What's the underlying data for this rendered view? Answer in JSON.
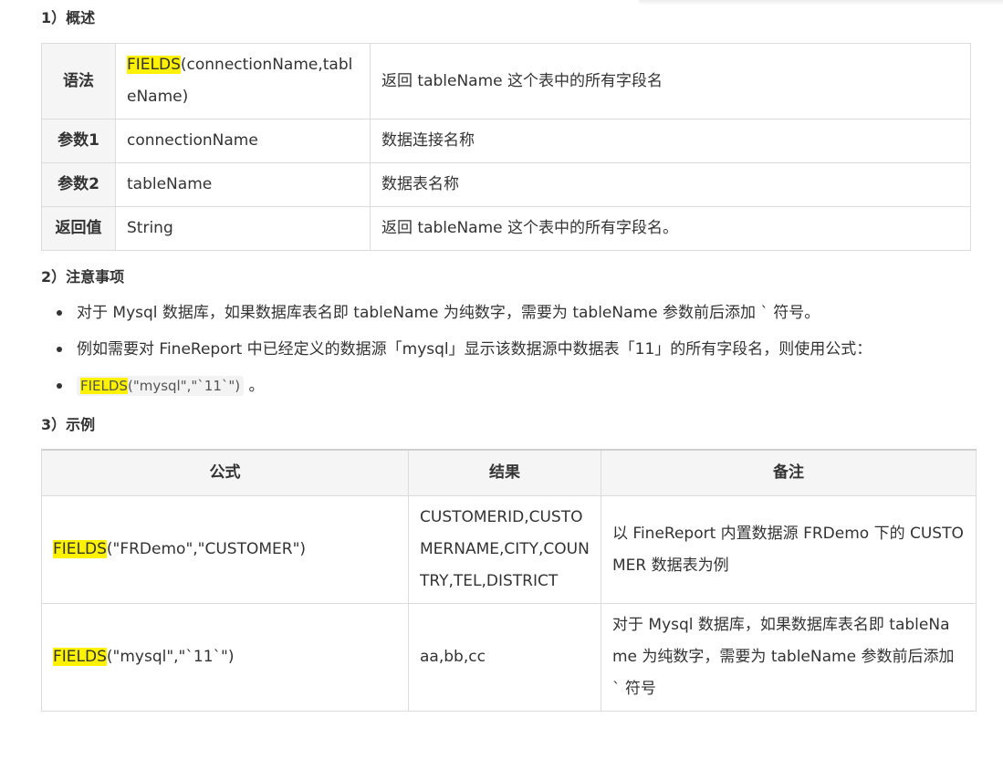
{
  "sections": {
    "overview_heading": "1）概述",
    "notes_heading": "2）注意事项",
    "example_heading": "3）示例"
  },
  "syntax_table": {
    "rows": [
      {
        "key": "语法",
        "fn": "FIELDS",
        "args": "(connectionName,tableName)",
        "desc": "返回 tableName 这个表中的所有字段名"
      },
      {
        "key": "参数1",
        "value": "connectionName",
        "desc": "数据连接名称"
      },
      {
        "key": "参数2",
        "value": "tableName",
        "desc": "数据表名称"
      },
      {
        "key": "返回值",
        "value": "String",
        "desc": "返回 tableName 这个表中的所有字段名。"
      }
    ]
  },
  "notes": {
    "items": [
      "对于 Mysql 数据库，如果数据库表名即 tableName 为纯数字，需要为 tableName 参数前后添加 ` 符号。",
      "例如需要对 FineReport 中已经定义的数据源「mysql」显示该数据源中数据表「11」的所有字段名，则使用公式："
    ],
    "code_fn": "FIELDS",
    "code_args": "(\"mysql\",\"`11`\")",
    "code_suffix": " 。"
  },
  "example_table": {
    "headers": [
      "公式",
      "结果",
      "备注"
    ],
    "rows": [
      {
        "fn": "FIELDS",
        "args": "(\"FRDemo\",\"CUSTOMER\")",
        "result": "CUSTOMERID,CUSTOMERNAME,CITY,COUNTRY,TEL,DISTRICT",
        "note": "以 FineReport 内置数据源 FRDemo 下的 CUSTOMER 数据表为例"
      },
      {
        "fn": "FIELDS",
        "args": "(\"mysql\",\"`11`\")",
        "result": "aa,bb,cc",
        "note": "对于 Mysql 数据库，如果数据库表名即 tableName 为纯数字，需要为 tableName 参数前后添加 ` 符号"
      }
    ]
  },
  "colors": {
    "highlight": "#fff200",
    "header_bg": "#f5f5f5",
    "border": "#dcdcdc"
  }
}
